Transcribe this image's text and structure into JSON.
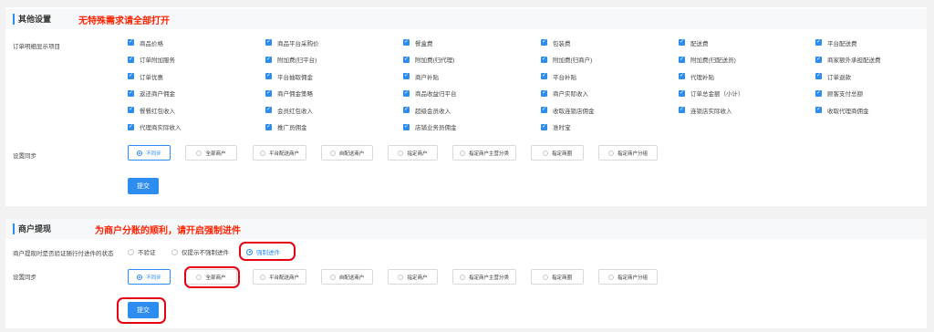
{
  "section1": {
    "title": "其他设置",
    "note": "无特殊需求请全部打开",
    "order_label": "订单明细显示项目",
    "items": [
      [
        "商品价格",
        "商品平台采购价",
        "餐盒费",
        "包装费",
        "配送费",
        "平台配送费"
      ],
      [
        "订单附加服务",
        "附加费(归平台)",
        "附加费(归代理)",
        "附加费(归商户)",
        "附加费(归配送员)",
        "商家额外承担配送费"
      ],
      [
        "订单优惠",
        "平台抽取佣金",
        "商户补贴",
        "平台补贴",
        "代理补贴",
        "订单退款"
      ],
      [
        "返还商户佣金",
        "商户佣金策略",
        "商品收益归平台",
        "商户实际收入",
        "订单总金额（小计）",
        "顾客支付总额"
      ],
      [
        "餐餐红包收入",
        "会员红包收入",
        "超级会员收入",
        "收取连锁店佣金",
        "连锁店实际收入",
        "收取代理商佣金"
      ],
      [
        "代理商实际收入",
        "推广员佣金",
        "店铺业务员佣金",
        "准时宝"
      ]
    ],
    "sync_label": "设置同步",
    "sync_options": [
      "不同步",
      "全部商户",
      "平台配送商户",
      "自配送商户",
      "指定商户",
      "指定商户主营分类",
      "指定商圈",
      "指定商户分组"
    ],
    "submit": "提交"
  },
  "section2": {
    "title": "商户提现",
    "note": "为商户分账的顺利，请开启强制进件",
    "withdraw_label": "商户提现时是否验证随行付进件的状态",
    "withdraw_options": [
      "不验证",
      "仅提示不强制进件",
      "强制进件"
    ],
    "sync_label": "设置同步",
    "sync_options": [
      "不同步",
      "全部商户",
      "平台配送商户",
      "自配送商户",
      "指定商户",
      "指定商户主营分类",
      "指定商圈",
      "指定商户分组"
    ],
    "submit": "提交"
  },
  "colors": {
    "accent": "#2d8cf0",
    "highlight": "#e60012",
    "note": "#ff2200"
  },
  "icons": {
    "checkbox": "check-icon",
    "radio": "radio-icon"
  }
}
